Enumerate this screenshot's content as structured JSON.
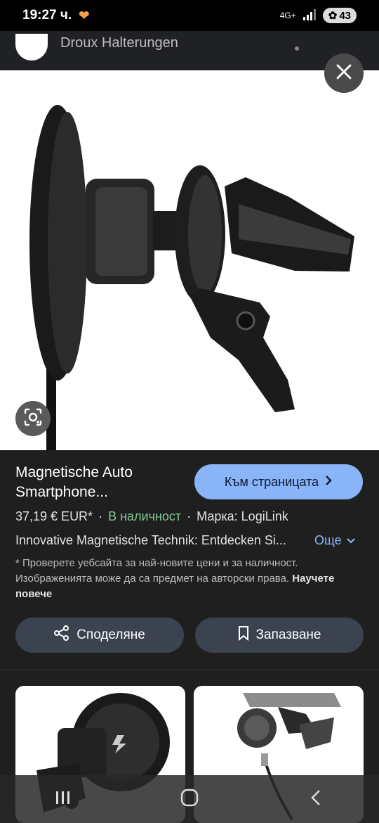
{
  "status": {
    "time": "19:27 ч.",
    "network": "4G+",
    "battery": "43"
  },
  "behind": {
    "text": "Droux Halterungen"
  },
  "product": {
    "title": "Magnetische Auto Smartphone...",
    "visit_label": "Към страницата",
    "price": "37,19 € EUR*",
    "stock": "В наличност",
    "brand": "Марка: LogiLink",
    "description": "Innovative Magnetische Technik: Entdecken Si...",
    "more_label": "Още",
    "note": "* Проверете уебсайта за най-новите цени и за наличност. Изображенията може да са предмет на авторски права.",
    "learn_more": "Научете повече"
  },
  "actions": {
    "share_label": "Споделяне",
    "save_label": "Запазване"
  },
  "colors": {
    "accent": "#8ab4f8",
    "stock_green": "#81c995",
    "background": "#1f1f1f"
  }
}
